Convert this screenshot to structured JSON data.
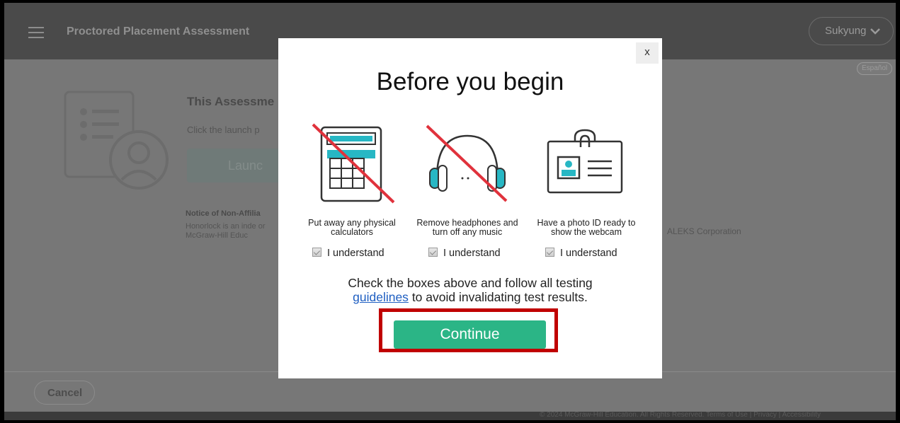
{
  "header": {
    "title": "Proctored Placement Assessment",
    "user_name": "Sukyung",
    "language_label": "Español"
  },
  "background": {
    "heading": "This Assessme",
    "instruction": "Click the launch p",
    "launch_label": "Launc",
    "notice_title": "Notice of Non-Affilia",
    "notice_text": "Honorlock is an inde or McGraw-Hill Educ",
    "notice_right": "ALEKS Corporation"
  },
  "footer": {
    "cancel_label": "Cancel",
    "copyright": "© 2024 McGraw-Hill Education. All Rights Reserved.   Terms of Use   |   Privacy   |   Accessibility"
  },
  "modal": {
    "close_label": "x",
    "title": "Before you begin",
    "items": [
      {
        "icon": "calculator-crossed-icon",
        "caption": "Put away any physical calculators",
        "check_label": "I understand"
      },
      {
        "icon": "headphones-crossed-icon",
        "caption": "Remove headphones and turn off any music",
        "check_label": "I understand"
      },
      {
        "icon": "photo-id-icon",
        "caption": "Have a photo ID ready to show the webcam",
        "check_label": "I understand"
      }
    ],
    "instruction_pre": "Check the boxes above and follow all testing",
    "guidelines_link": "guidelines",
    "instruction_post": "to avoid invalidating test results.",
    "continue_label": "Continue"
  },
  "colors": {
    "accent_green": "#2bb586",
    "teal_icon": "#27b7c4",
    "strike_red": "#e0323c",
    "highlight_red": "#c00000",
    "link_blue": "#1f5fc2"
  }
}
